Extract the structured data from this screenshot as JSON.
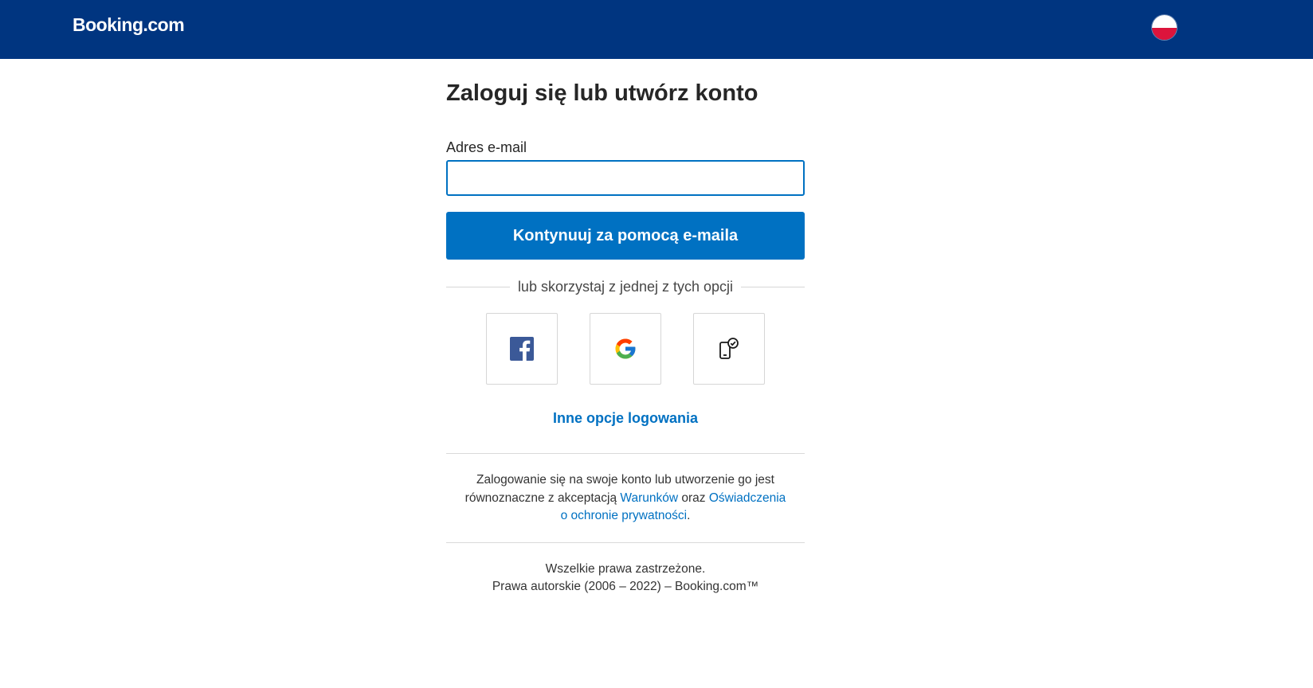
{
  "header": {
    "logo": "Booking.com",
    "flag_icon": "poland-flag-icon"
  },
  "login": {
    "title": "Zaloguj się lub utwórz konto",
    "email_label": "Adres e-mail",
    "email_value": "",
    "continue_label": "Kontynuuj za pomocą e-maila",
    "divider_text": "lub skorzystaj z jednej z tych opcji",
    "providers": [
      {
        "icon": "facebook-icon"
      },
      {
        "icon": "google-icon"
      },
      {
        "icon": "phone-check-icon"
      }
    ],
    "more_options": "Inne opcje logowania"
  },
  "legal": {
    "text_1": "Zalogowanie się na swoje konto lub utworzenie go jest równoznaczne z akceptacją ",
    "terms_link": "Warunków",
    "text_2": " oraz ",
    "privacy_link": "Oświadczenia o ochronie prywatności",
    "text_3": "."
  },
  "footer": {
    "line_1": "Wszelkie prawa zastrzeżone.",
    "line_2": "Prawa autorskie (2006 – 2022) – Booking.com™"
  },
  "colors": {
    "header_bg": "#003580",
    "primary": "#0071c2",
    "facebook": "#3b5998"
  }
}
